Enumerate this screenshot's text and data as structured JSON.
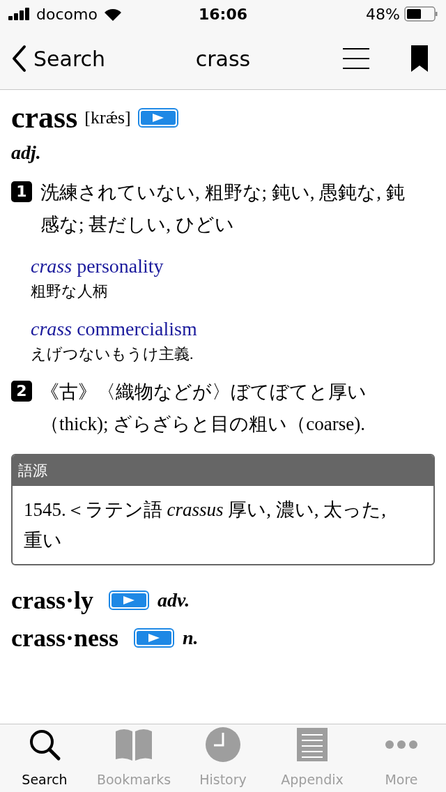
{
  "status_bar": {
    "carrier": "docomo",
    "time": "16:06",
    "battery": "48%"
  },
  "nav": {
    "back": "Search",
    "title": "crass"
  },
  "entry": {
    "headword": "crass",
    "pronunciation": "[krǽs]",
    "pos": "adj.",
    "senses": [
      {
        "number": "1",
        "text": "洗練されていない, 粗野な; 鈍い, 愚鈍な, 鈍感な; 甚だしい, ひどい",
        "examples": [
          {
            "phrase": "*crass* personality",
            "translation": "粗野な人柄"
          },
          {
            "phrase": "*crass* commercialism",
            "translation": "えげつないもうけ主義."
          }
        ]
      },
      {
        "number": "2",
        "text": "《古》〈織物などが〉ぼてぼてと厚い（thick); ざらざらと目の粗い（coarse)."
      }
    ],
    "etymology": {
      "label": "語源",
      "text": "1545.＜ラテン語 *crassus* 厚い, 濃い, 太った, 重い"
    },
    "derivatives": [
      {
        "word": "crass·ly",
        "pos": "adv."
      },
      {
        "word": "crass·ness",
        "pos": "n."
      }
    ]
  },
  "tabs": [
    {
      "kind": "search",
      "label": "Search",
      "selected": true
    },
    {
      "kind": "bookmarks",
      "label": "Bookmarks",
      "selected": false
    },
    {
      "kind": "history",
      "label": "History",
      "selected": false
    },
    {
      "kind": "appendix",
      "label": "Appendix",
      "selected": false
    },
    {
      "kind": "more",
      "label": "More",
      "selected": false
    }
  ]
}
